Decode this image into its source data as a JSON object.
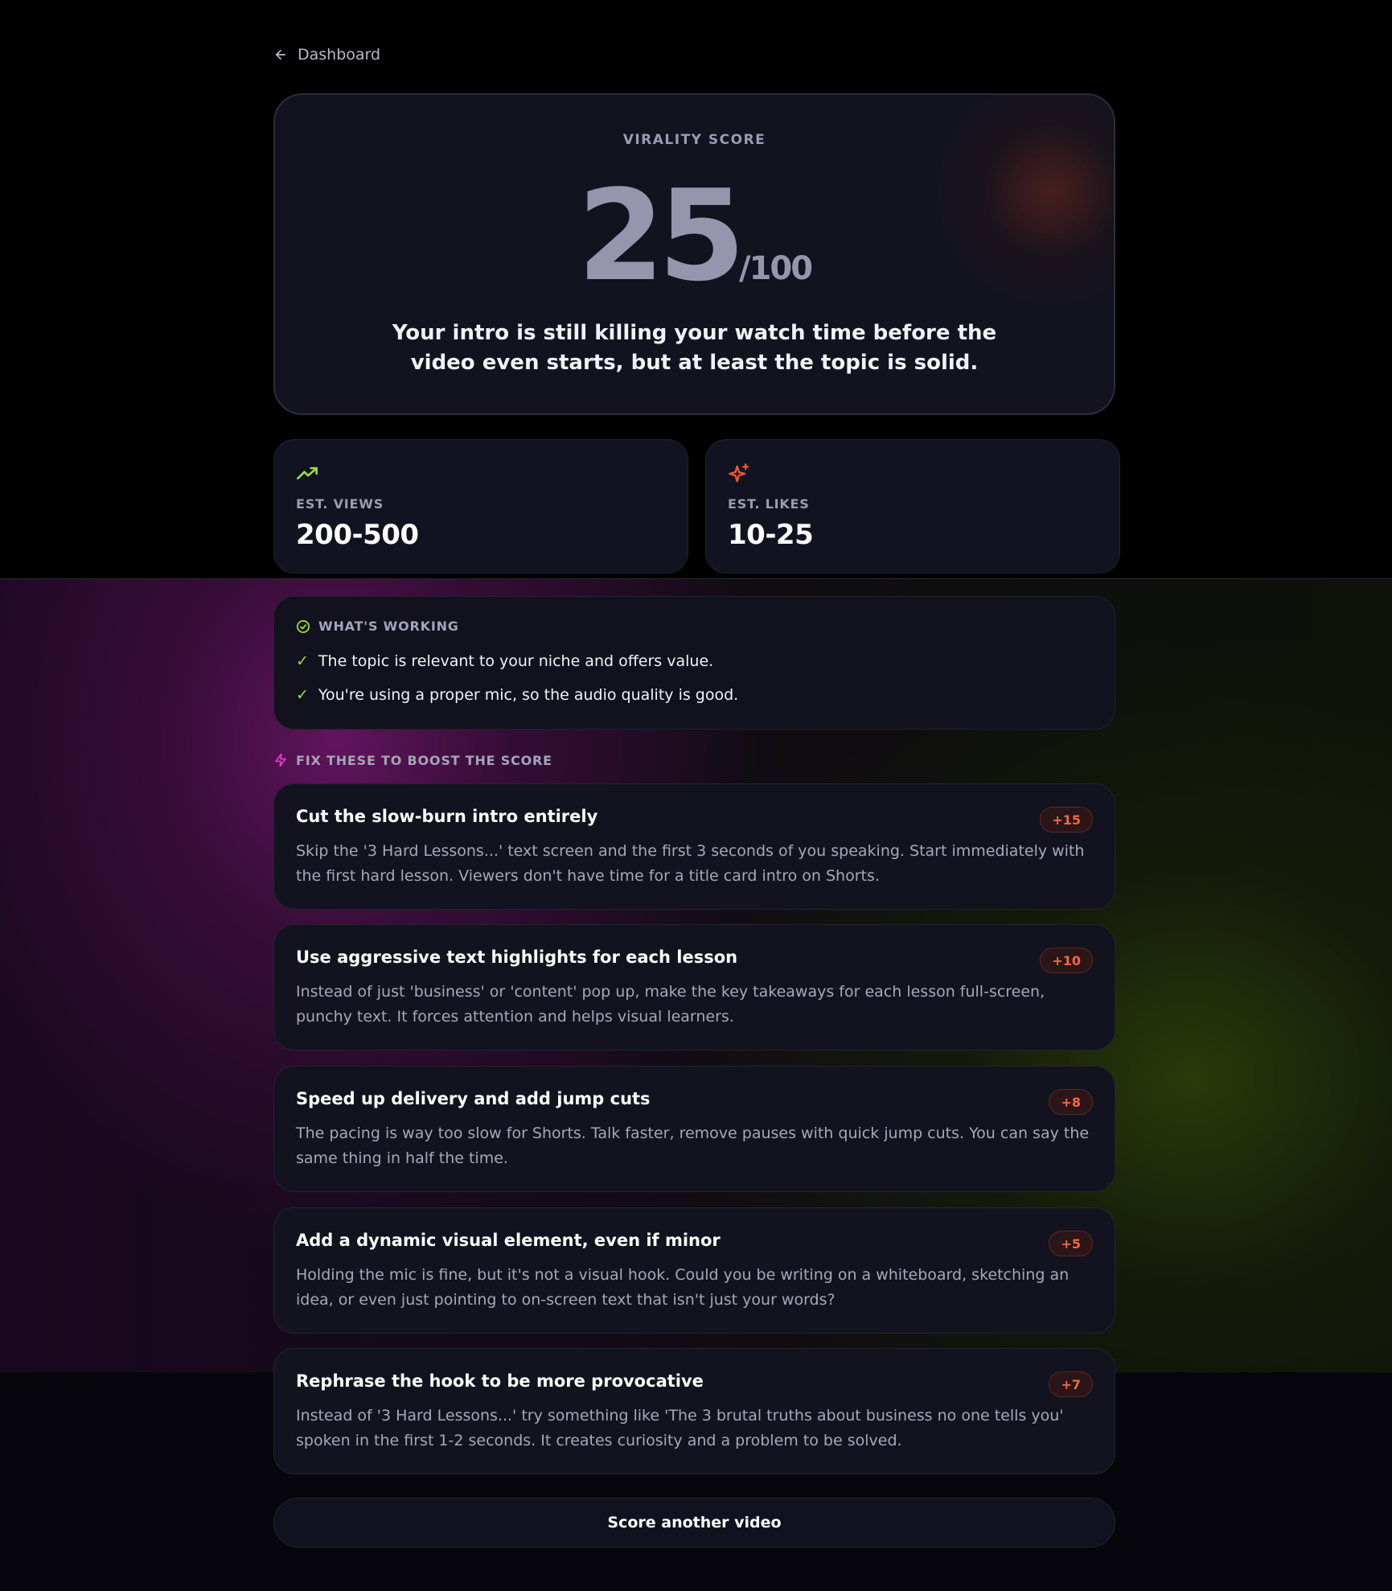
{
  "nav": {
    "back_label": "Dashboard"
  },
  "score": {
    "label": "VIRALITY SCORE",
    "value": "25",
    "max": "/100",
    "summary": "Your intro is still killing your watch time before the video even starts, but at least the topic is solid."
  },
  "stats": {
    "views": {
      "label": "EST. VIEWS",
      "value": "200-500",
      "icon": "trending-up-icon",
      "color": "#9be03a"
    },
    "likes": {
      "label": "EST. LIKES",
      "value": "10-25",
      "icon": "sparkles-icon",
      "color": "#ef5a32"
    }
  },
  "working": {
    "title": "WHAT'S WORKING",
    "items": [
      "The topic is relevant to your niche and offers value.",
      "You're using a proper mic, so the audio quality is good."
    ]
  },
  "fixes": {
    "title": "FIX THESE TO BOOST THE SCORE",
    "items": [
      {
        "title": "Cut the slow-burn intro entirely",
        "badge": "+15",
        "desc": "Skip the '3 Hard Lessons...' text screen and the first 3 seconds of you speaking. Start immediately with the first hard lesson. Viewers don't have time for a title card intro on Shorts."
      },
      {
        "title": "Use aggressive text highlights for each lesson",
        "badge": "+10",
        "desc": "Instead of just 'business' or 'content' pop up, make the key takeaways for each lesson full-screen, punchy text. It forces attention and helps visual learners."
      },
      {
        "title": "Speed up delivery and add jump cuts",
        "badge": "+8",
        "desc": "The pacing is way too slow for Shorts. Talk faster, remove pauses with quick jump cuts. You can say the same thing in half the time."
      },
      {
        "title": "Add a dynamic visual element, even if minor",
        "badge": "+5",
        "desc": "Holding the mic is fine, but it's not a visual hook. Could you be writing on a whiteboard, sketching an idea, or even just pointing to on-screen text that isn't just your words?"
      },
      {
        "title": "Rephrase the hook to be more provocative",
        "badge": "+7",
        "desc": "Instead of '3 Hard Lessons...' try something like 'The 3 brutal truths about business no one tells you' spoken in the first 1-2 seconds. It creates curiosity and a problem to be solved."
      }
    ]
  },
  "cta": {
    "label": "Score another video"
  }
}
